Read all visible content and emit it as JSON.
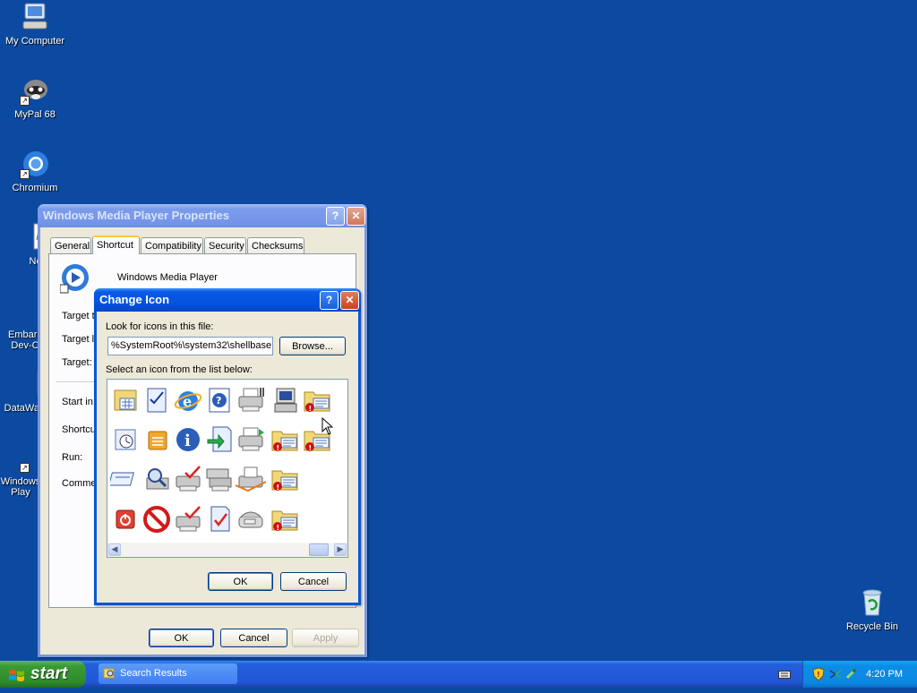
{
  "desktop": {
    "icons": [
      {
        "label": "My Computer",
        "icon": "computer-icon"
      },
      {
        "label": "MyPal 68",
        "icon": "mypal-browser-icon"
      },
      {
        "label": "Chromium",
        "icon": "chromium-icon"
      },
      {
        "label": "Notepa",
        "icon": "notepad-icon"
      },
      {
        "label": "Embarc Dev-C",
        "icon": "dev-cpp-icon"
      },
      {
        "label": "DataWa",
        "icon": "datawatch-icon"
      },
      {
        "label": "Windows Play",
        "icon": "media-player-icon"
      },
      {
        "label": "Recycle Bin",
        "icon": "recycle-bin-icon"
      }
    ]
  },
  "props_window": {
    "title": "Windows Media Player Properties",
    "help_glyph": "?",
    "close_glyph": "✕",
    "tabs": [
      "General",
      "Shortcut",
      "Compatibility",
      "Security",
      "Checksums"
    ],
    "active_tab": "Shortcut",
    "app_name": "Windows Media Player",
    "field_labels": [
      "Target ty",
      "Target lo",
      "Target:",
      "Start in:",
      "Shortcut",
      "Run:",
      "Commen"
    ],
    "buttons": {
      "ok": "OK",
      "cancel": "Cancel",
      "apply": "Apply"
    }
  },
  "change_icon": {
    "title": "Change Icon",
    "help_glyph": "?",
    "close_glyph": "✕",
    "look_label": "Look for icons in this file:",
    "file_path": "%SystemRoot%\\system32\\shellbase",
    "browse_label": "Browse...",
    "select_label": "Select an icon from the list below:",
    "icons": [
      [
        "calendar-folder-icon",
        "checklist-icon",
        "internet-explorer-icon",
        "help-icon",
        "printer-icon",
        "computer-tower-icon",
        "folder-error-icon"
      ],
      [
        "clock-icon",
        "box-icon",
        "info-icon",
        "document-arrow-icon",
        "network-printer-icon",
        "folder-error-icon",
        "folder-error-icon"
      ],
      [
        "card-icon",
        "search-icon",
        "printer-check-icon",
        "printer-stack-icon",
        "printer-paper-icon",
        "folder-error-icon",
        ""
      ],
      [
        "power-icon",
        "no-entry-icon",
        "printer-check-icon",
        "document-check-icon",
        "fax-icon",
        "folder-error-icon",
        ""
      ]
    ],
    "buttons": {
      "ok": "OK",
      "cancel": "Cancel"
    }
  },
  "taskbar": {
    "start_label": "start",
    "task_label": "Search Results",
    "clock": "4:20 PM"
  },
  "colors": {
    "desktop": "#0b4aa0",
    "titlebar": "#0554e0",
    "start_green": "#2f8a2b"
  }
}
